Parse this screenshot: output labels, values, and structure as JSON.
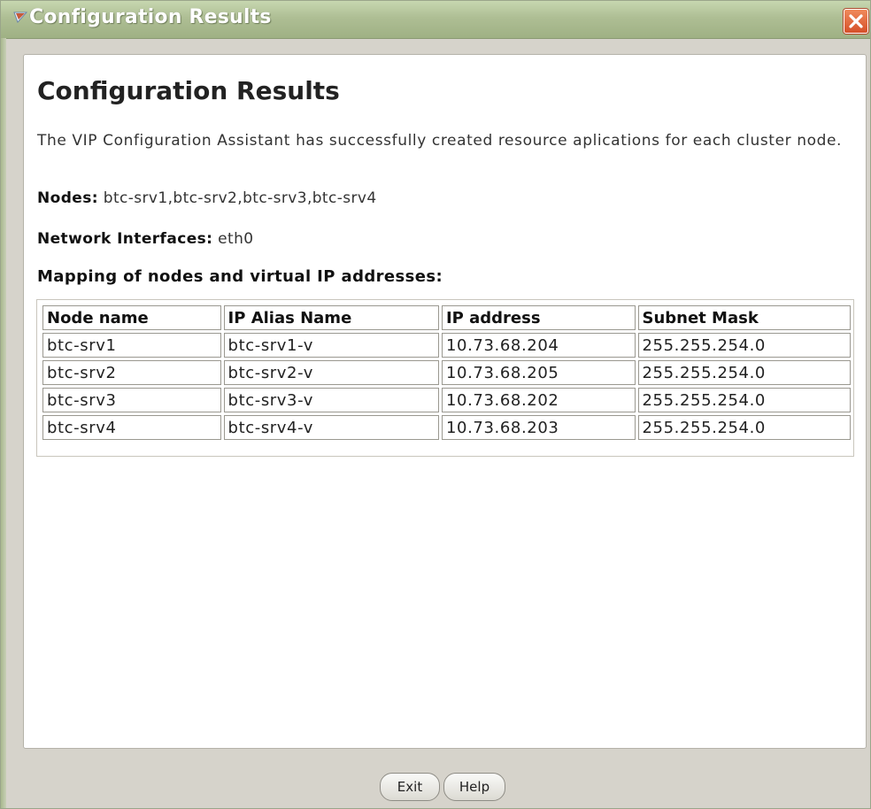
{
  "window": {
    "title": "Configuration Results",
    "colors": {
      "titlebar": "#aebe94",
      "close_button": "#e0653a",
      "content_bg": "#ffffff",
      "frame_bg": "#d6d3cb"
    },
    "icons": {
      "app": "flag-icon",
      "close": "close-icon"
    }
  },
  "content": {
    "heading": "Configuration Results",
    "description": "The VIP Configuration Assistant has successfully created resource aplications for each cluster node.",
    "nodes_label": "Nodes:",
    "nodes_value": "btc-srv1,btc-srv2,btc-srv3,btc-srv4",
    "interfaces_label": "Network Interfaces:",
    "interfaces_value": "eth0",
    "mapping_heading": "Mapping of nodes and virtual IP addresses:"
  },
  "table": {
    "headers": [
      "Node name",
      "IP Alias Name",
      "IP address",
      "Subnet Mask"
    ],
    "rows": [
      [
        "btc-srv1",
        "btc-srv1-v",
        "10.73.68.204",
        "255.255.254.0"
      ],
      [
        "btc-srv2",
        "btc-srv2-v",
        "10.73.68.205",
        "255.255.254.0"
      ],
      [
        "btc-srv3",
        "btc-srv3-v",
        "10.73.68.202",
        "255.255.254.0"
      ],
      [
        "btc-srv4",
        "btc-srv4-v",
        "10.73.68.203",
        "255.255.254.0"
      ]
    ]
  },
  "footer": {
    "exit_label": "Exit",
    "help_label": "Help"
  }
}
